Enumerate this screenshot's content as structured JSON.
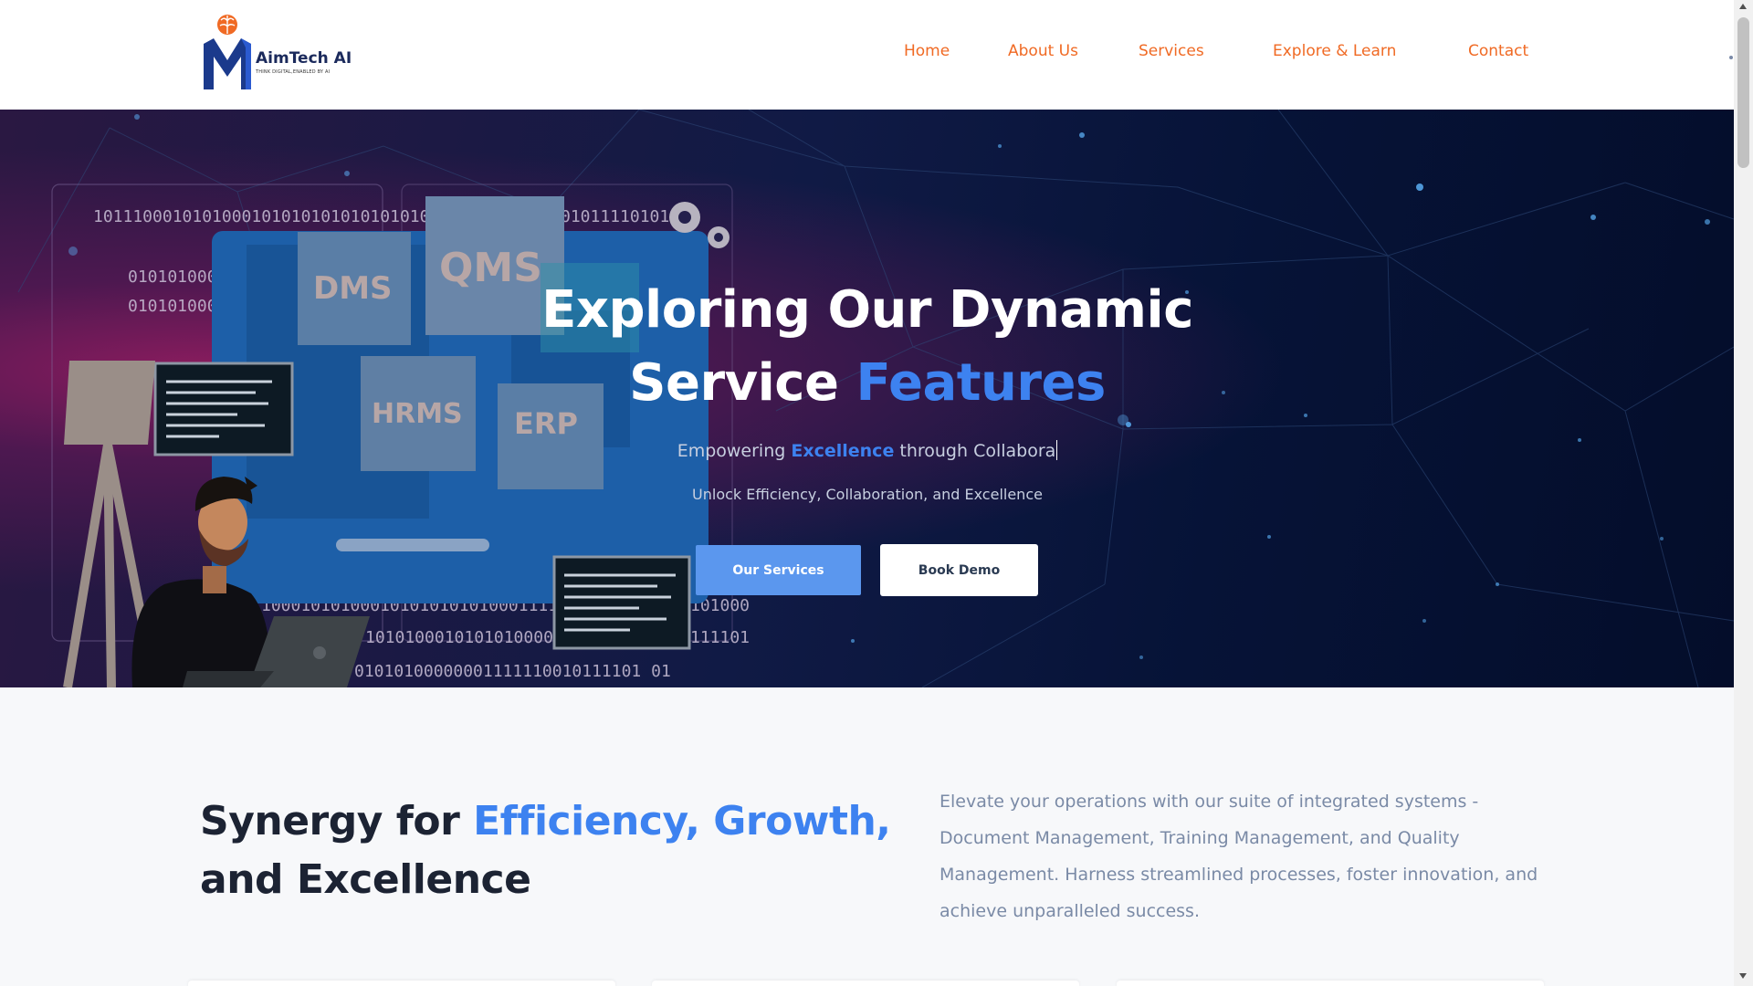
{
  "brand": {
    "name": "AimTech AI",
    "tagline": "THINK DIGITAL,ENABLED BY AI",
    "logo_colors": {
      "primary": "#1b3a8c",
      "accent": "#f06a24"
    }
  },
  "nav": {
    "items": [
      {
        "label": "Home"
      },
      {
        "label": "About Us"
      },
      {
        "label": "Services"
      },
      {
        "label": "Explore & Learn"
      },
      {
        "label": "Contact"
      }
    ],
    "color": "#f06a24"
  },
  "hero": {
    "title_line1": "Exploring Our Dynamic",
    "title_line2_plain": "Service ",
    "title_line2_accent": "Features",
    "subtitle_pre": "Empowering ",
    "subtitle_accent": "Excellence",
    "subtitle_post": " through Collabora",
    "tagline": "Unlock Efficiency, Collaboration, and Excellence",
    "primary_button": "Our Services",
    "secondary_button": "Book Demo",
    "illustration": {
      "modules": [
        "DMS",
        "QMS",
        "HRMS",
        "ERP"
      ],
      "binary_lines": [
        "1011100010101000101010101010101010",
        "010101000",
        "010101000",
        "01011110101",
        "1000101010001010101010100011111",
        "10100000",
        "10101000101010100000",
        "11110101",
        "01010100000001111110010111101 01"
      ]
    },
    "accent_color": "#3d82f0"
  },
  "synergy": {
    "title_pre": "Synergy for ",
    "title_accent": "Efficiency, Growth,",
    "title_post": "and Excellence",
    "description": "Elevate your operations with our suite of integrated systems - Document Management, Training Management, and Quality Management. Harness streamlined processes, foster innovation, and achieve unparalleled success."
  }
}
